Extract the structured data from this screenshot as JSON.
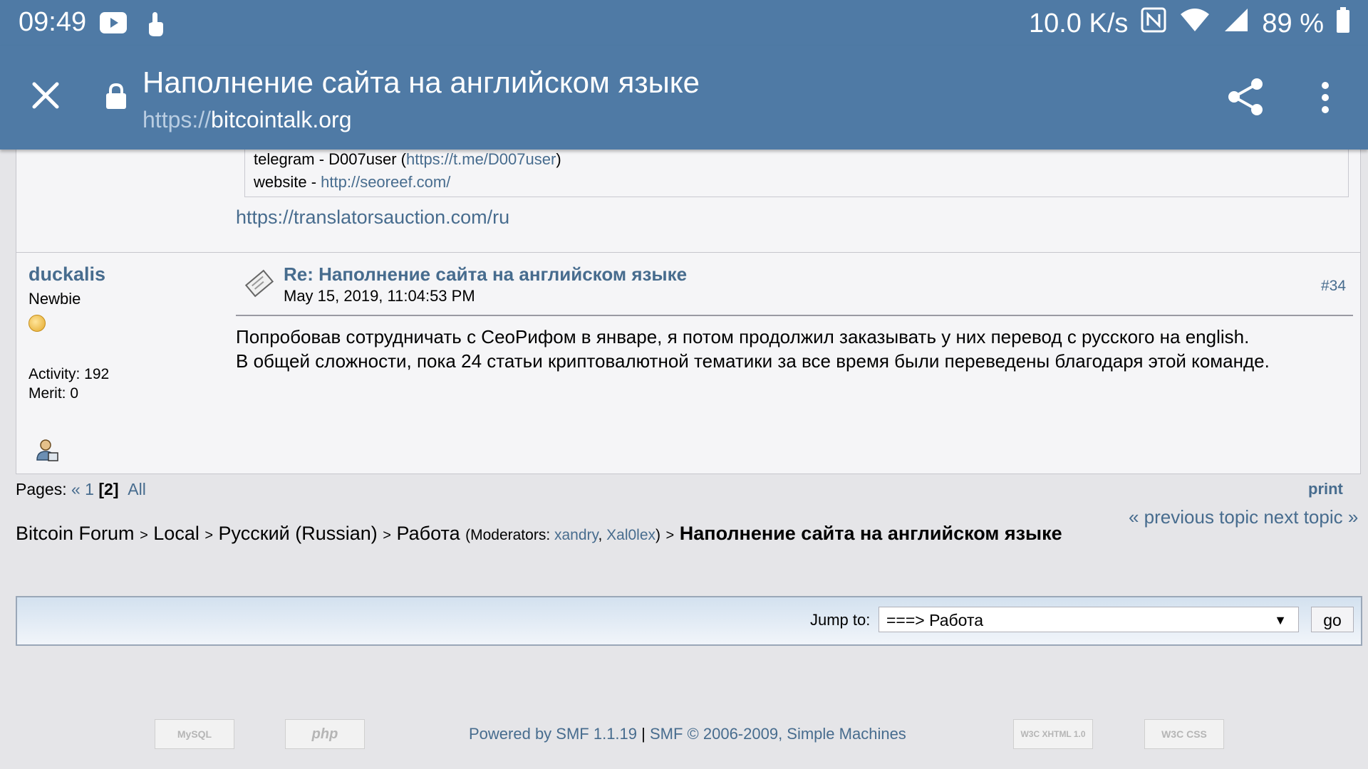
{
  "status": {
    "time": "09:49",
    "speed": "10.0 K/s",
    "battery": "89 %"
  },
  "toolbar": {
    "title": "Наполнение сайта на английском языке",
    "url_scheme": "https://",
    "url_host": "bitcointalk.org"
  },
  "prev_post": {
    "telegram_label": "telegram - D007user (",
    "telegram_link": "https://t.me/D007user",
    "telegram_close": ")",
    "website_label": "website - ",
    "website_link": "http://seoreef.com/",
    "signature_link": "https://translatorsauction.com/ru"
  },
  "post": {
    "author": "duckalis",
    "rank": "Newbie",
    "activity": "Activity: 192",
    "merit": "Merit: 0",
    "title": "Re: Наполнение сайта на английском языке",
    "date": "May 15, 2019, 11:04:53 PM",
    "number": "#34",
    "body_line1": "Попробовав сотрудничать с СеоРифом в январе, я потом продолжил заказывать у них перевод с русского на english.",
    "body_line2": "В общей сложности, пока 24 статьи криптовалютной тематики за все время были переведены благодаря этой команде."
  },
  "pagination": {
    "label": "Pages:",
    "prev": "« 1",
    "current": "[2]",
    "all": "All",
    "print": "print"
  },
  "topic_nav": {
    "previous": "« previous topic",
    "next": "next topic »"
  },
  "breadcrumb": {
    "forum": "Bitcoin Forum",
    "sep": ">",
    "local": "Local",
    "russian": "Русский (Russian)",
    "board": "Работа",
    "mods_label": "(Moderators: ",
    "mod1": "xandry",
    "comma": ", ",
    "mod2": "Xal0lex",
    "mods_close": ")",
    "topic": "Наполнение сайта на английском языке"
  },
  "jump": {
    "label": "Jump to:",
    "selected": "===> Работа",
    "go": "go"
  },
  "footer": {
    "powered": "Powered by SMF 1.1.19",
    "sep": "|",
    "copyright": "SMF © 2006-2009, Simple Machines",
    "badge_mysql": "MySQL",
    "badge_php": "php",
    "badge_xhtml": "W3C XHTML 1.0",
    "badge_css": "W3C CSS"
  }
}
